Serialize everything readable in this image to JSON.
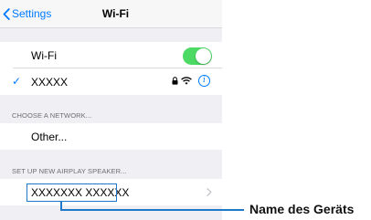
{
  "navbar": {
    "back_label": "Settings",
    "title": "Wi-Fi"
  },
  "wifi_row": {
    "label": "Wi-Fi",
    "toggle_state": "on"
  },
  "connected_network": {
    "checkmark": "✓",
    "name": "XXXXX",
    "info_glyph": "i",
    "icons": [
      "lock-icon",
      "wifi-icon",
      "info-icon"
    ]
  },
  "choose_network": {
    "header": "CHOOSE A NETWORK...",
    "other_label": "Other..."
  },
  "airplay": {
    "header": "SET UP NEW AIRPLAY SPEAKER...",
    "device_name": "XXXXXXX  XXXXXX"
  },
  "annotation": {
    "label": "Name des Geräts"
  },
  "colors": {
    "ios_blue": "#007aff",
    "toggle_green": "#4cd964",
    "annotation_blue": "#1f78c8",
    "grouped_bg": "#efeff4"
  }
}
